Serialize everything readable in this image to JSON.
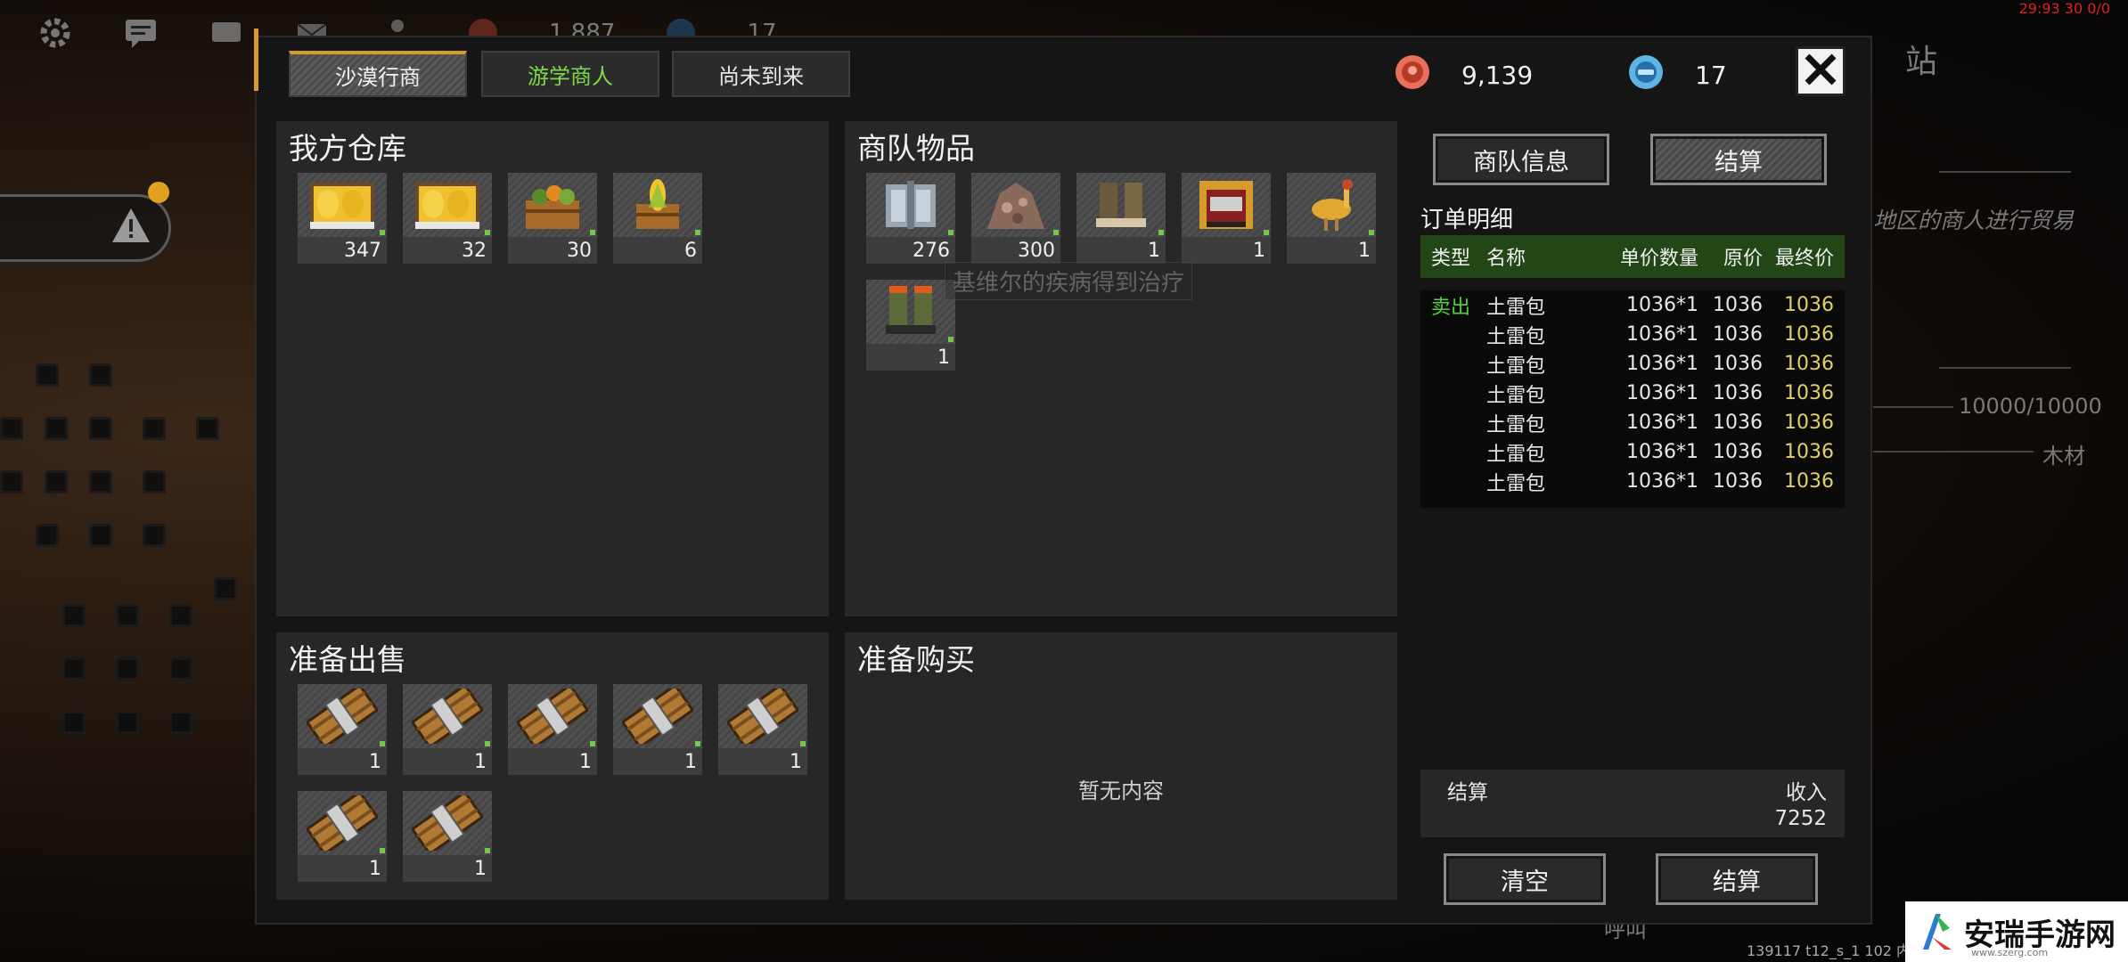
{
  "scene": {
    "top_value_1": "1,887",
    "top_value_2": "17",
    "side_text_1": "站",
    "side_text_2": "地区的商人进行贸易",
    "side_text_3": "10000/10000",
    "side_text_4": "木材",
    "side_text_5": "呼叫",
    "bottom_status": "139117 t12_s_1 102 内",
    "timer": "29:93 30 0/0",
    "tooltip": "基维尔的疾病得到治疗",
    "watermark_title": "安瑞手游网",
    "watermark_url": "www.szerg.com"
  },
  "tabs": [
    {
      "label": "沙漠行商",
      "active": true
    },
    {
      "label": "游学商人",
      "active": false
    },
    {
      "label": "尚未到来",
      "active": false
    }
  ],
  "currency": {
    "coin": "9,139",
    "gem": "17"
  },
  "panels": {
    "warehouse": {
      "title": "我方仓库",
      "items": [
        {
          "icon": "corn-tray-icon",
          "qty": "347"
        },
        {
          "icon": "corn-tray-icon",
          "qty": "32"
        },
        {
          "icon": "fruit-crate-icon",
          "qty": "30"
        },
        {
          "icon": "corn-crate-icon",
          "qty": "6"
        }
      ]
    },
    "caravan": {
      "title": "商队物品",
      "items": [
        {
          "icon": "steel-plate-icon",
          "qty": "276"
        },
        {
          "icon": "ore-pile-icon",
          "qty": "300"
        },
        {
          "icon": "leather-boots-icon",
          "qty": "1"
        },
        {
          "icon": "armor-vest-icon",
          "qty": "1"
        },
        {
          "icon": "ostrich-icon",
          "qty": "1"
        },
        {
          "icon": "combat-boots-icon",
          "qty": "1"
        }
      ]
    },
    "to_sell": {
      "title": "准备出售",
      "items": [
        {
          "icon": "landmine-pack-icon",
          "qty": "1"
        },
        {
          "icon": "landmine-pack-icon",
          "qty": "1"
        },
        {
          "icon": "landmine-pack-icon",
          "qty": "1"
        },
        {
          "icon": "landmine-pack-icon",
          "qty": "1"
        },
        {
          "icon": "landmine-pack-icon",
          "qty": "1"
        },
        {
          "icon": "landmine-pack-icon",
          "qty": "1"
        },
        {
          "icon": "landmine-pack-icon",
          "qty": "1"
        }
      ]
    },
    "to_buy": {
      "title": "准备购买",
      "empty_text": "暂无内容"
    }
  },
  "buttons": {
    "caravan_info": "商队信息",
    "settle_top": "结算",
    "clear": "清空",
    "settle_bottom": "结算"
  },
  "order": {
    "title": "订单明细",
    "columns": {
      "type": "类型",
      "name": "名称",
      "unit_qty": "单价数量",
      "orig_price": "原价",
      "final_price": "最终价"
    },
    "rows": [
      {
        "type": "卖出",
        "name": "土雷包",
        "unit_qty": "1036*1",
        "orig": "1036",
        "final": "1036"
      },
      {
        "type": "",
        "name": "土雷包",
        "unit_qty": "1036*1",
        "orig": "1036",
        "final": "1036"
      },
      {
        "type": "",
        "name": "土雷包",
        "unit_qty": "1036*1",
        "orig": "1036",
        "final": "1036"
      },
      {
        "type": "",
        "name": "土雷包",
        "unit_qty": "1036*1",
        "orig": "1036",
        "final": "1036"
      },
      {
        "type": "",
        "name": "土雷包",
        "unit_qty": "1036*1",
        "orig": "1036",
        "final": "1036"
      },
      {
        "type": "",
        "name": "土雷包",
        "unit_qty": "1036*1",
        "orig": "1036",
        "final": "1036"
      },
      {
        "type": "",
        "name": "土雷包",
        "unit_qty": "1036*1",
        "orig": "1036",
        "final": "1036"
      }
    ]
  },
  "settlement": {
    "label": "结算",
    "income_label": "收入",
    "income_value": "7252"
  },
  "colors": {
    "accent": "#d79b2c",
    "sell_type": "#51d13c",
    "final_price": "#e3cf6a",
    "header_green": "#234617",
    "tab_green": "#7dd94a"
  }
}
